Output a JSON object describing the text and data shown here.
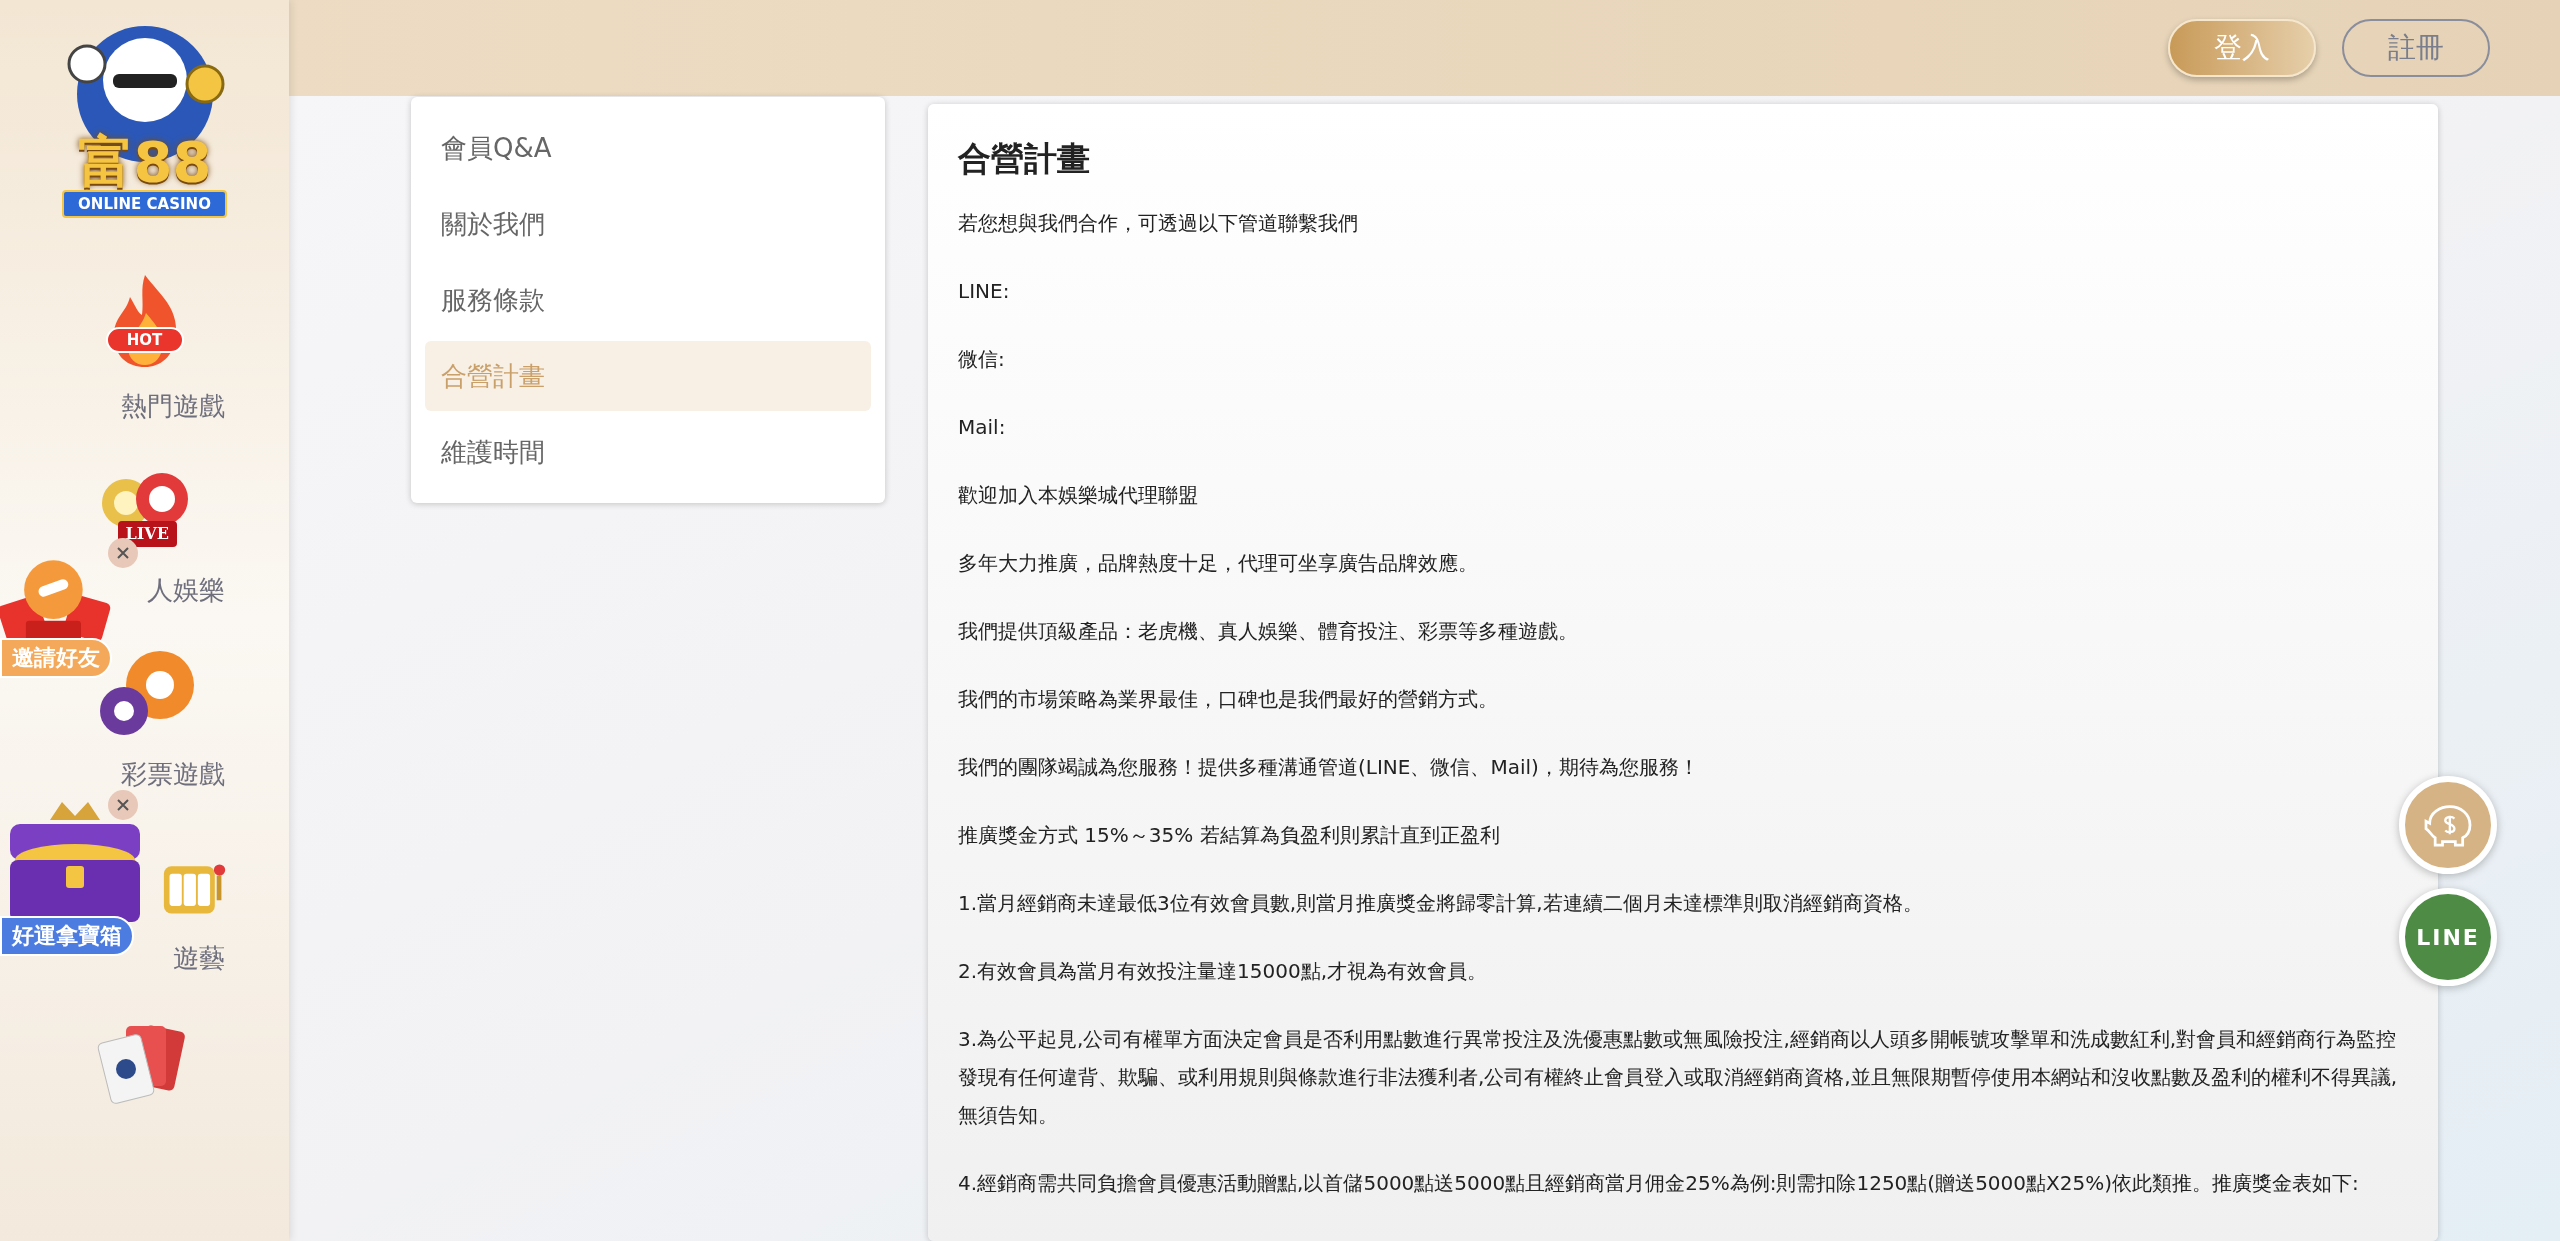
{
  "logo": {
    "name": "富88",
    "tagline": "ONLINE CASINO"
  },
  "sidebar": {
    "items": [
      {
        "kind": "hot",
        "badge": "HOT",
        "label": "熱門遊戲"
      },
      {
        "kind": "live",
        "badge": "LIVE",
        "label": "人娛樂"
      },
      {
        "kind": "lottery",
        "label": "彩票遊戲"
      },
      {
        "kind": "slots",
        "label": "遊藝"
      },
      {
        "kind": "cards"
      }
    ]
  },
  "promos": [
    {
      "kind": "invite",
      "label": "邀請好友"
    },
    {
      "kind": "chest",
      "label": "好運拿寶箱"
    }
  ],
  "header": {
    "buttons": [
      {
        "kind": "primary",
        "label": "登入"
      },
      {
        "kind": "outline",
        "label": "註冊"
      }
    ]
  },
  "menu": {
    "items": [
      {
        "label": "會員Q&A",
        "selected": false
      },
      {
        "label": "關於我們",
        "selected": false
      },
      {
        "label": "服務條款",
        "selected": false
      },
      {
        "label": "合營計畫",
        "selected": true
      },
      {
        "label": "維護時間",
        "selected": false
      }
    ]
  },
  "article": {
    "title": "合營計畫",
    "paragraphs": [
      "若您想與我們合作，可透過以下管道聯繫我們",
      "LINE:",
      "微信:",
      "Mail:",
      "歡迎加入本娛樂城代理聯盟",
      "多年大力推廣，品牌熱度十足，代理可坐享廣告品牌效應。",
      "我們提供頂級產品：老虎機、真人娛樂、體育投注、彩票等多種遊戲。",
      "我們的市場策略為業界最佳，口碑也是我們最好的營銷方式。",
      "我們的團隊竭誠為您服務！提供多種溝通管道(LINE、微信、Mail)，期待為您服務！",
      "推廣獎金方式 15%～35% 若結算為負盈利則累計直到正盈利",
      "1.當月經銷商未達最低3位有效會員數,則當月推廣獎金將歸零計算,若連續二個月未達標準則取消經銷商資格。",
      "2.有效會員為當月有效投注量達15000點,才視為有效會員。",
      "3.為公平起見,公司有權單方面決定會員是否利用點數進行異常投注及洗優惠點數或無風險投注,經銷商以人頭多開帳號攻擊單和洗成數紅利,對會員和經銷商行為監控發現有任何違背、欺騙、或利用規則與條款進行非法獲利者,公司有權終止會員登入或取消經銷商資格,並且無限期暫停使用本網站和沒收點數及盈利的權利不得異議,無須告知。",
      "4.經銷商需共同負擔會員優惠活動贈點,以首儲5000點送5000點且經銷商當月佣金25%為例:則需扣除1250點(贈送5000點X25%)依此類推。推廣獎金表如下:"
    ]
  },
  "floating_buttons": [
    {
      "kind": "savings"
    },
    {
      "kind": "line",
      "label": "LINE"
    }
  ]
}
